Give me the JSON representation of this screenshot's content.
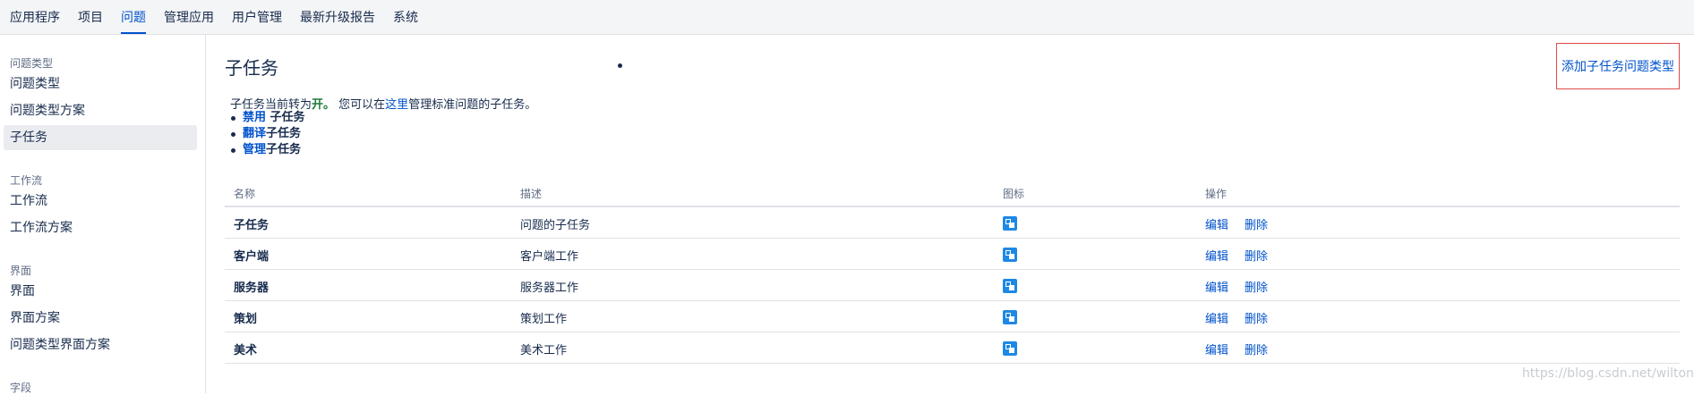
{
  "topnav": {
    "tabs": [
      {
        "label": "应用程序",
        "active": false
      },
      {
        "label": "项目",
        "active": false
      },
      {
        "label": "问题",
        "active": true
      },
      {
        "label": "管理应用",
        "active": false
      },
      {
        "label": "用户管理",
        "active": false
      },
      {
        "label": "最新升级报告",
        "active": false
      },
      {
        "label": "系统",
        "active": false
      }
    ]
  },
  "sidebar": {
    "sections": [
      {
        "heading": "问题类型",
        "items": [
          "问题类型",
          "问题类型方案",
          "子任务"
        ]
      },
      {
        "heading": "工作流",
        "items": [
          "工作流",
          "工作流方案"
        ]
      },
      {
        "heading": "界面",
        "items": [
          "界面",
          "界面方案",
          "问题类型界面方案"
        ]
      },
      {
        "heading": "字段",
        "items": []
      }
    ],
    "selected": "子任务"
  },
  "main": {
    "title": "子任务",
    "add_button": "添加子任务问题类型",
    "status": {
      "prefix": "子任务当前转为",
      "state": "开。",
      "middle": " 您可以在",
      "link": "这里",
      "suffix": "管理标准问题的子任务。"
    },
    "links": [
      {
        "link": "禁用",
        "rest": " 子任务"
      },
      {
        "link": "翻译",
        "rest": "子任务"
      },
      {
        "link": "管理",
        "rest": "子任务"
      }
    ],
    "table": {
      "headers": {
        "name": "名称",
        "desc": "描述",
        "icon": "图标",
        "ops": "操作"
      },
      "rows": [
        {
          "name": "子任务",
          "desc": "问题的子任务",
          "icon": "subtask-icon",
          "edit": "编辑",
          "del": "删除"
        },
        {
          "name": "客户端",
          "desc": "客户端工作",
          "icon": "subtask-icon",
          "edit": "编辑",
          "del": "删除"
        },
        {
          "name": "服务器",
          "desc": "服务器工作",
          "icon": "subtask-icon",
          "edit": "编辑",
          "del": "删除"
        },
        {
          "name": "策划",
          "desc": "策划工作",
          "icon": "subtask-icon",
          "edit": "编辑",
          "del": "删除"
        },
        {
          "name": "美术",
          "desc": "美术工作",
          "icon": "subtask-icon",
          "edit": "编辑",
          "del": "删除"
        }
      ]
    }
  },
  "watermark": "https://blog.csdn.net/wilton"
}
